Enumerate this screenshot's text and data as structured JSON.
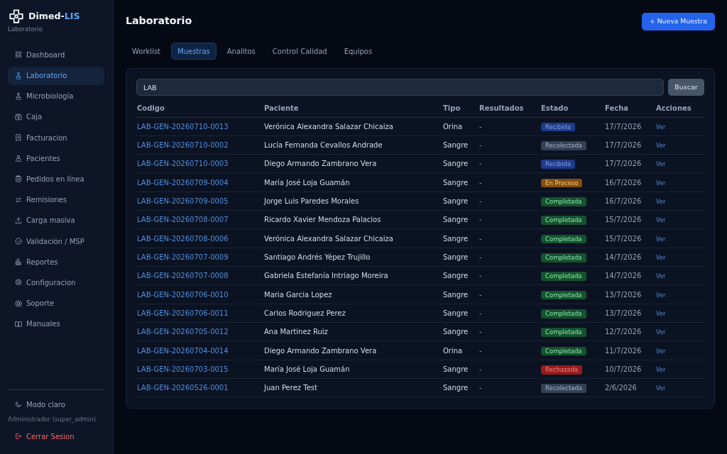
{
  "sidebar": {
    "brand": {
      "name": "Dimed-",
      "accent": "LIS",
      "subtitle": "Laboratorio"
    },
    "items": [
      {
        "label": "Dashboard",
        "selected": false
      },
      {
        "label": "Laboratorio",
        "selected": true
      },
      {
        "label": "Microbiología",
        "selected": false
      },
      {
        "label": "Caja",
        "selected": false
      },
      {
        "label": "Facturacion",
        "selected": false
      },
      {
        "label": "Pacientes",
        "selected": false
      },
      {
        "label": "Pedidos en línea",
        "selected": false
      },
      {
        "label": "Remisiones",
        "selected": false
      },
      {
        "label": "Carga masiva",
        "selected": false
      },
      {
        "label": "Validación / MSP",
        "selected": false
      },
      {
        "label": "Reportes",
        "selected": false
      },
      {
        "label": "Configuracion",
        "selected": false
      },
      {
        "label": "Soporte",
        "selected": false
      },
      {
        "label": "Manuales",
        "selected": false
      }
    ],
    "theme_toggle": "Modo claro",
    "user": "Administrador (super_admin)",
    "logout": "Cerrar Sesion"
  },
  "page": {
    "title": "Laboratorio",
    "primary_button": "+ Nueva Muestra"
  },
  "tabs": [
    {
      "label": "Worklist",
      "selected": false
    },
    {
      "label": "Muestras",
      "selected": true
    },
    {
      "label": "Analitos",
      "selected": false
    },
    {
      "label": "Control Calidad",
      "selected": false
    },
    {
      "label": "Equipos",
      "selected": false
    }
  ],
  "search": {
    "value": "LAB",
    "button": "Buscar"
  },
  "table": {
    "columns": [
      "Codigo",
      "Paciente",
      "Tipo",
      "Resultados",
      "Estado",
      "Fecha",
      "Acciones"
    ],
    "rows": [
      {
        "code": "LAB-GEN-20260710-0013",
        "patient": "Verónica Alexandra Salazar Chicaiza",
        "type": "Orina",
        "results": "-",
        "status": {
          "label": "Recibida",
          "color": "#1e3a8a"
        },
        "date": "17/7/2026",
        "action": "Ver"
      },
      {
        "code": "LAB-GEN-20260710-0002",
        "patient": "Lucía Fernanda Cevallos Andrade",
        "type": "Sangre",
        "results": "-",
        "status": {
          "label": "Recolectada",
          "color": "#334155"
        },
        "date": "17/7/2026",
        "action": "Ver"
      },
      {
        "code": "LAB-GEN-20260710-0003",
        "patient": "Diego Armando Zambrano Vera",
        "type": "Sangre",
        "results": "-",
        "status": {
          "label": "Recibida",
          "color": "#1e3a8a"
        },
        "date": "17/7/2026",
        "action": "Ver"
      },
      {
        "code": "LAB-GEN-20260709-0004",
        "patient": "María José Loja Guamán",
        "type": "Sangre",
        "results": "-",
        "status": {
          "label": "En Proceso",
          "color": "#854d0e"
        },
        "date": "16/7/2026",
        "action": "Ver"
      },
      {
        "code": "LAB-GEN-20260709-0005",
        "patient": "Jorge Luis Paredes Morales",
        "type": "Sangre",
        "results": "-",
        "status": {
          "label": "Completada",
          "color": "#14532d"
        },
        "date": "16/7/2026",
        "action": "Ver"
      },
      {
        "code": "LAB-GEN-20260708-0007",
        "patient": "Ricardo Xavier Mendoza Palacios",
        "type": "Sangre",
        "results": "-",
        "status": {
          "label": "Completada",
          "color": "#14532d"
        },
        "date": "15/7/2026",
        "action": "Ver"
      },
      {
        "code": "LAB-GEN-20260708-0006",
        "patient": "Verónica Alexandra Salazar Chicaiza",
        "type": "Sangre",
        "results": "-",
        "status": {
          "label": "Completada",
          "color": "#14532d"
        },
        "date": "15/7/2026",
        "action": "Ver"
      },
      {
        "code": "LAB-GEN-20260707-0009",
        "patient": "Santiago Andrés Yépez Trujillo",
        "type": "Sangre",
        "results": "-",
        "status": {
          "label": "Completada",
          "color": "#14532d"
        },
        "date": "14/7/2026",
        "action": "Ver"
      },
      {
        "code": "LAB-GEN-20260707-0008",
        "patient": "Gabriela Estefanía Intriago Moreira",
        "type": "Sangre",
        "results": "-",
        "status": {
          "label": "Completada",
          "color": "#14532d"
        },
        "date": "14/7/2026",
        "action": "Ver"
      },
      {
        "code": "LAB-GEN-20260706-0010",
        "patient": "Maria Garcia Lopez",
        "type": "Sangre",
        "results": "-",
        "status": {
          "label": "Completada",
          "color": "#14532d"
        },
        "date": "13/7/2026",
        "action": "Ver"
      },
      {
        "code": "LAB-GEN-20260706-0011",
        "patient": "Carlos Rodriguez Perez",
        "type": "Sangre",
        "results": "-",
        "status": {
          "label": "Completada",
          "color": "#14532d"
        },
        "date": "13/7/2026",
        "action": "Ver"
      },
      {
        "code": "LAB-GEN-20260705-0012",
        "patient": "Ana Martinez Ruiz",
        "type": "Sangre",
        "results": "-",
        "status": {
          "label": "Completada",
          "color": "#14532d"
        },
        "date": "12/7/2026",
        "action": "Ver"
      },
      {
        "code": "LAB-GEN-20260704-0014",
        "patient": "Diego Armando Zambrano Vera",
        "type": "Orina",
        "results": "-",
        "status": {
          "label": "Completada",
          "color": "#14532d"
        },
        "date": "11/7/2026",
        "action": "Ver"
      },
      {
        "code": "LAB-GEN-20260703-0015",
        "patient": "María José Loja Guamán",
        "type": "Sangre",
        "results": "-",
        "status": {
          "label": "Rechazada",
          "color": "#991b1b"
        },
        "date": "10/7/2026",
        "action": "Ver"
      },
      {
        "code": "LAB-GEN-20260526-0001",
        "patient": "Juan Perez Test",
        "type": "Sangre",
        "results": "-",
        "status": {
          "label": "Recolectada",
          "color": "#334155"
        },
        "date": "2/6/2026",
        "action": "Ver"
      }
    ]
  }
}
